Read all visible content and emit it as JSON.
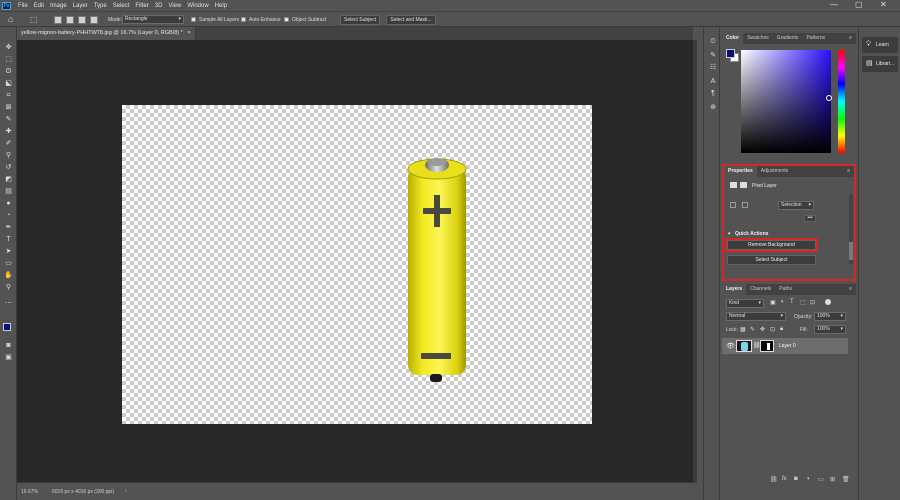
{
  "app": {
    "logo": "Ps"
  },
  "menu": [
    "File",
    "Edit",
    "Image",
    "Layer",
    "Type",
    "Select",
    "Filter",
    "3D",
    "View",
    "Window",
    "Help"
  ],
  "window_controls": {
    "minimize": "—",
    "maximize": "▢",
    "close": "✕"
  },
  "options": {
    "mode_label": "Mode:",
    "mode_value": "Rectangle",
    "sample_all_layers": "Sample All Layers",
    "auto_enhance": "Auto-Enhance",
    "object_subtract": "Object Subtract",
    "select_subject": "Select Subject",
    "select_and_mask": "Select and Mask..."
  },
  "document": {
    "tab_title": "yellow-mignon-battery-PHHTW78.jpg @ 16.7% (Layer 0, RGB/8) *",
    "tab_close": "×"
  },
  "status": {
    "zoom": "16.67%",
    "dimensions": "6016 px x 4016 px (300 ppi)",
    "arrow": "›"
  },
  "color_panel": {
    "tabs": [
      "Color",
      "Swatches",
      "Gradients",
      "Patterns"
    ],
    "foreground": "#0b0f73",
    "background": "#ffffff"
  },
  "properties_panel": {
    "tabs": [
      "Properties",
      "Adjustments"
    ],
    "layer_type": "Pixel Layer",
    "selection_dropdown": "Selection",
    "more": "•••",
    "quick_actions_title": "Quick Actions",
    "remove_background": "Remove Background",
    "select_subject": "Select Subject"
  },
  "layers_panel": {
    "tabs": [
      "Layers",
      "Channels",
      "Paths"
    ],
    "kind_filter": "Kind",
    "blend_mode": "Normal",
    "opacity_label": "Opacity:",
    "opacity_value": "100%",
    "lock_label": "Lock:",
    "fill_label": "Fill:",
    "fill_value": "100%",
    "layers": [
      {
        "name": "Layer 0"
      }
    ]
  },
  "learn_panel": {
    "learn": "Learn",
    "libraries": "Librari..."
  },
  "colors": {
    "highlight": "#d6262b",
    "battery": "#f0e614",
    "canvas_bg": "#282828"
  }
}
